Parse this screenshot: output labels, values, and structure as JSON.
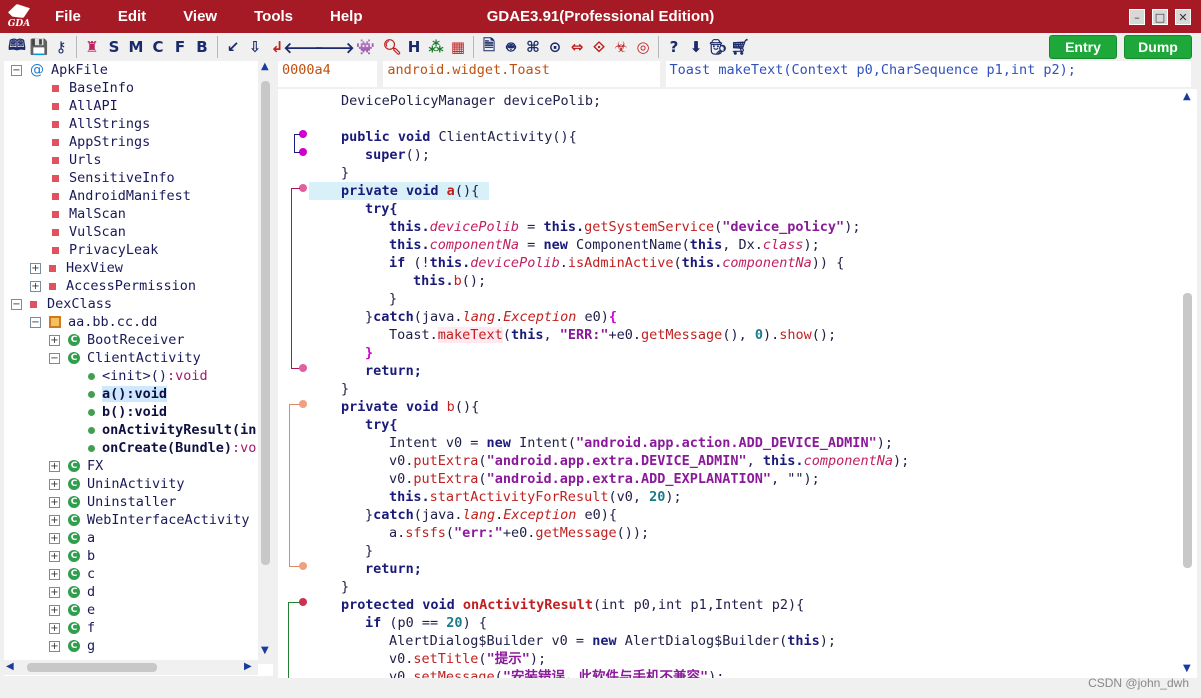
{
  "app": {
    "logo_text": "GDA",
    "window_title": "GDAE3.91(Professional Edition)"
  },
  "menu": [
    "File",
    "Edit",
    "View",
    "Tools",
    "Help"
  ],
  "toolbar": {
    "letters": [
      "S",
      "M",
      "C",
      "F",
      "B"
    ],
    "h_letter": "H",
    "entry_label": "Entry",
    "dump_label": "Dump"
  },
  "tree": {
    "root1": "ApkFile",
    "apk_children": [
      "BaseInfo",
      "AllAPI",
      "AllStrings",
      "AppStrings",
      "Urls",
      "SensitiveInfo",
      "AndroidManifest",
      "MalScan",
      "VulScan",
      "PrivacyLeak",
      "HexView",
      "AccessPermission"
    ],
    "root2": "DexClass",
    "package": "aa.bb.cc.dd",
    "classes": [
      "BootReceiver",
      "ClientActivity"
    ],
    "methods": [
      {
        "name": "<init>()",
        "ret": ":void"
      },
      {
        "name": "a()",
        "ret": ":void"
      },
      {
        "name": "b()",
        "ret": ":void"
      },
      {
        "name": "onActivityResult(in",
        "ret": ""
      },
      {
        "name": "onCreate(Bundle)",
        "ret": ":vo"
      }
    ],
    "more_classes": [
      "FX",
      "UninActivity",
      "Uninstaller",
      "WebInterfaceActivity",
      "a",
      "b",
      "c",
      "d",
      "e",
      "f",
      "g"
    ]
  },
  "infobar": {
    "offset": "0000a4",
    "class": "android.widget.Toast",
    "method": "Toast makeText(Context p0,CharSequence p1,int p2);"
  },
  "code": {
    "l01": "DevicePolicyManager devicePolib;",
    "l02_a": "public void ",
    "l02_b": "ClientActivity(){",
    "l03_a": "super",
    "l03_b": "();",
    "l04": "}",
    "l05_a": "private void ",
    "l05_b": "a",
    "l05_c": "(){",
    "l06": "try{",
    "l07_a": "this.",
    "l07_b": "devicePolib",
    "l07_c": " = ",
    "l07_d": "this.",
    "l07_e": "getSystemService",
    "l07_f": "(",
    "l07_g": "\"device_policy\"",
    "l07_h": ");",
    "l08_a": "this.",
    "l08_b": "componentNa",
    "l08_c": " = ",
    "l08_d": "new ",
    "l08_e": "ComponentName(",
    "l08_f": "this",
    "l08_g": ", Dx.",
    "l08_h": "class",
    "l08_i": ");",
    "l09_a": "if ",
    "l09_b": "(!",
    "l09_c": "this.",
    "l09_d": "devicePolib",
    "l09_e": ".",
    "l09_f": "isAdminActive",
    "l09_g": "(",
    "l09_h": "this.",
    "l09_i": "componentNa",
    "l09_j": ")) {",
    "l10_a": "this.",
    "l10_b": "b",
    "l10_c": "();",
    "l11": "}",
    "l12_a": "}",
    "l12_b": "catch",
    "l12_c": "(java.",
    "l12_d": "lang",
    "l12_e": ".",
    "l12_f": "Exception",
    "l12_g": " e0)",
    "l12_h": "{",
    "l13_a": "Toast.",
    "l13_b": "makeText",
    "l13_c": "(",
    "l13_d": "this",
    "l13_e": ", ",
    "l13_f": "\"ERR:\"",
    "l13_g": "+e0.",
    "l13_h": "getMessage",
    "l13_i": "(), ",
    "l13_j": "0",
    "l13_k": ").",
    "l13_l": "show",
    "l13_m": "();",
    "l14": "}",
    "l15": "return;",
    "l16": "}",
    "l17_a": "private void ",
    "l17_b": "b",
    "l17_c": "(){",
    "l18": "try{",
    "l19_a": "Intent v0 = ",
    "l19_b": "new ",
    "l19_c": "Intent(",
    "l19_d": "\"android.app.action.ADD_DEVICE_ADMIN\"",
    "l19_e": ");",
    "l20_a": "v0.",
    "l20_b": "putExtra",
    "l20_c": "(",
    "l20_d": "\"android.app.extra.DEVICE_ADMIN\"",
    "l20_e": ", ",
    "l20_f": "this.",
    "l20_g": "componentNa",
    "l20_h": ");",
    "l21_a": "v0.",
    "l21_b": "putExtra",
    "l21_c": "(",
    "l21_d": "\"android.app.extra.ADD_EXPLANATION\"",
    "l21_e": ", \"\");",
    "l22_a": "this.",
    "l22_b": "startActivityForResult",
    "l22_c": "(v0, ",
    "l22_d": "20",
    "l22_e": ");",
    "l23_a": "}",
    "l23_b": "catch",
    "l23_c": "(java.",
    "l23_d": "lang",
    "l23_e": ".",
    "l23_f": "Exception",
    "l23_g": " e0){",
    "l24_a": "a.",
    "l24_b": "sfsfs",
    "l24_c": "(",
    "l24_d": "\"err:\"",
    "l24_e": "+e0.",
    "l24_f": "getMessage",
    "l24_g": "());",
    "l25": "}",
    "l26": "return;",
    "l27": "}",
    "l28_a": "protected void ",
    "l28_b": "onActivityResult",
    "l28_c": "(int p0,int p1,Intent p2){",
    "l29_a": "if ",
    "l29_b": "(p0 == ",
    "l29_c": "20",
    "l29_d": ") {",
    "l30_a": "AlertDialog$Builder v0 = ",
    "l30_b": "new ",
    "l30_c": "AlertDialog$Builder(",
    "l30_d": "this",
    "l30_e": ");",
    "l31_a": "v0.",
    "l31_b": "setTitle",
    "l31_c": "(",
    "l31_d": "\"提示\"",
    "l31_e": ");",
    "l32_a": "v0.",
    "l32_b": "setMessage",
    "l32_c": "(",
    "l32_d": "\"安装错误，此软件与手机不兼容\"",
    "l32_e": ");"
  },
  "watermark": "CSDN @john_dwh",
  "colors": {
    "titlebar": "#a51a24",
    "button_green": "#1fa83a"
  }
}
